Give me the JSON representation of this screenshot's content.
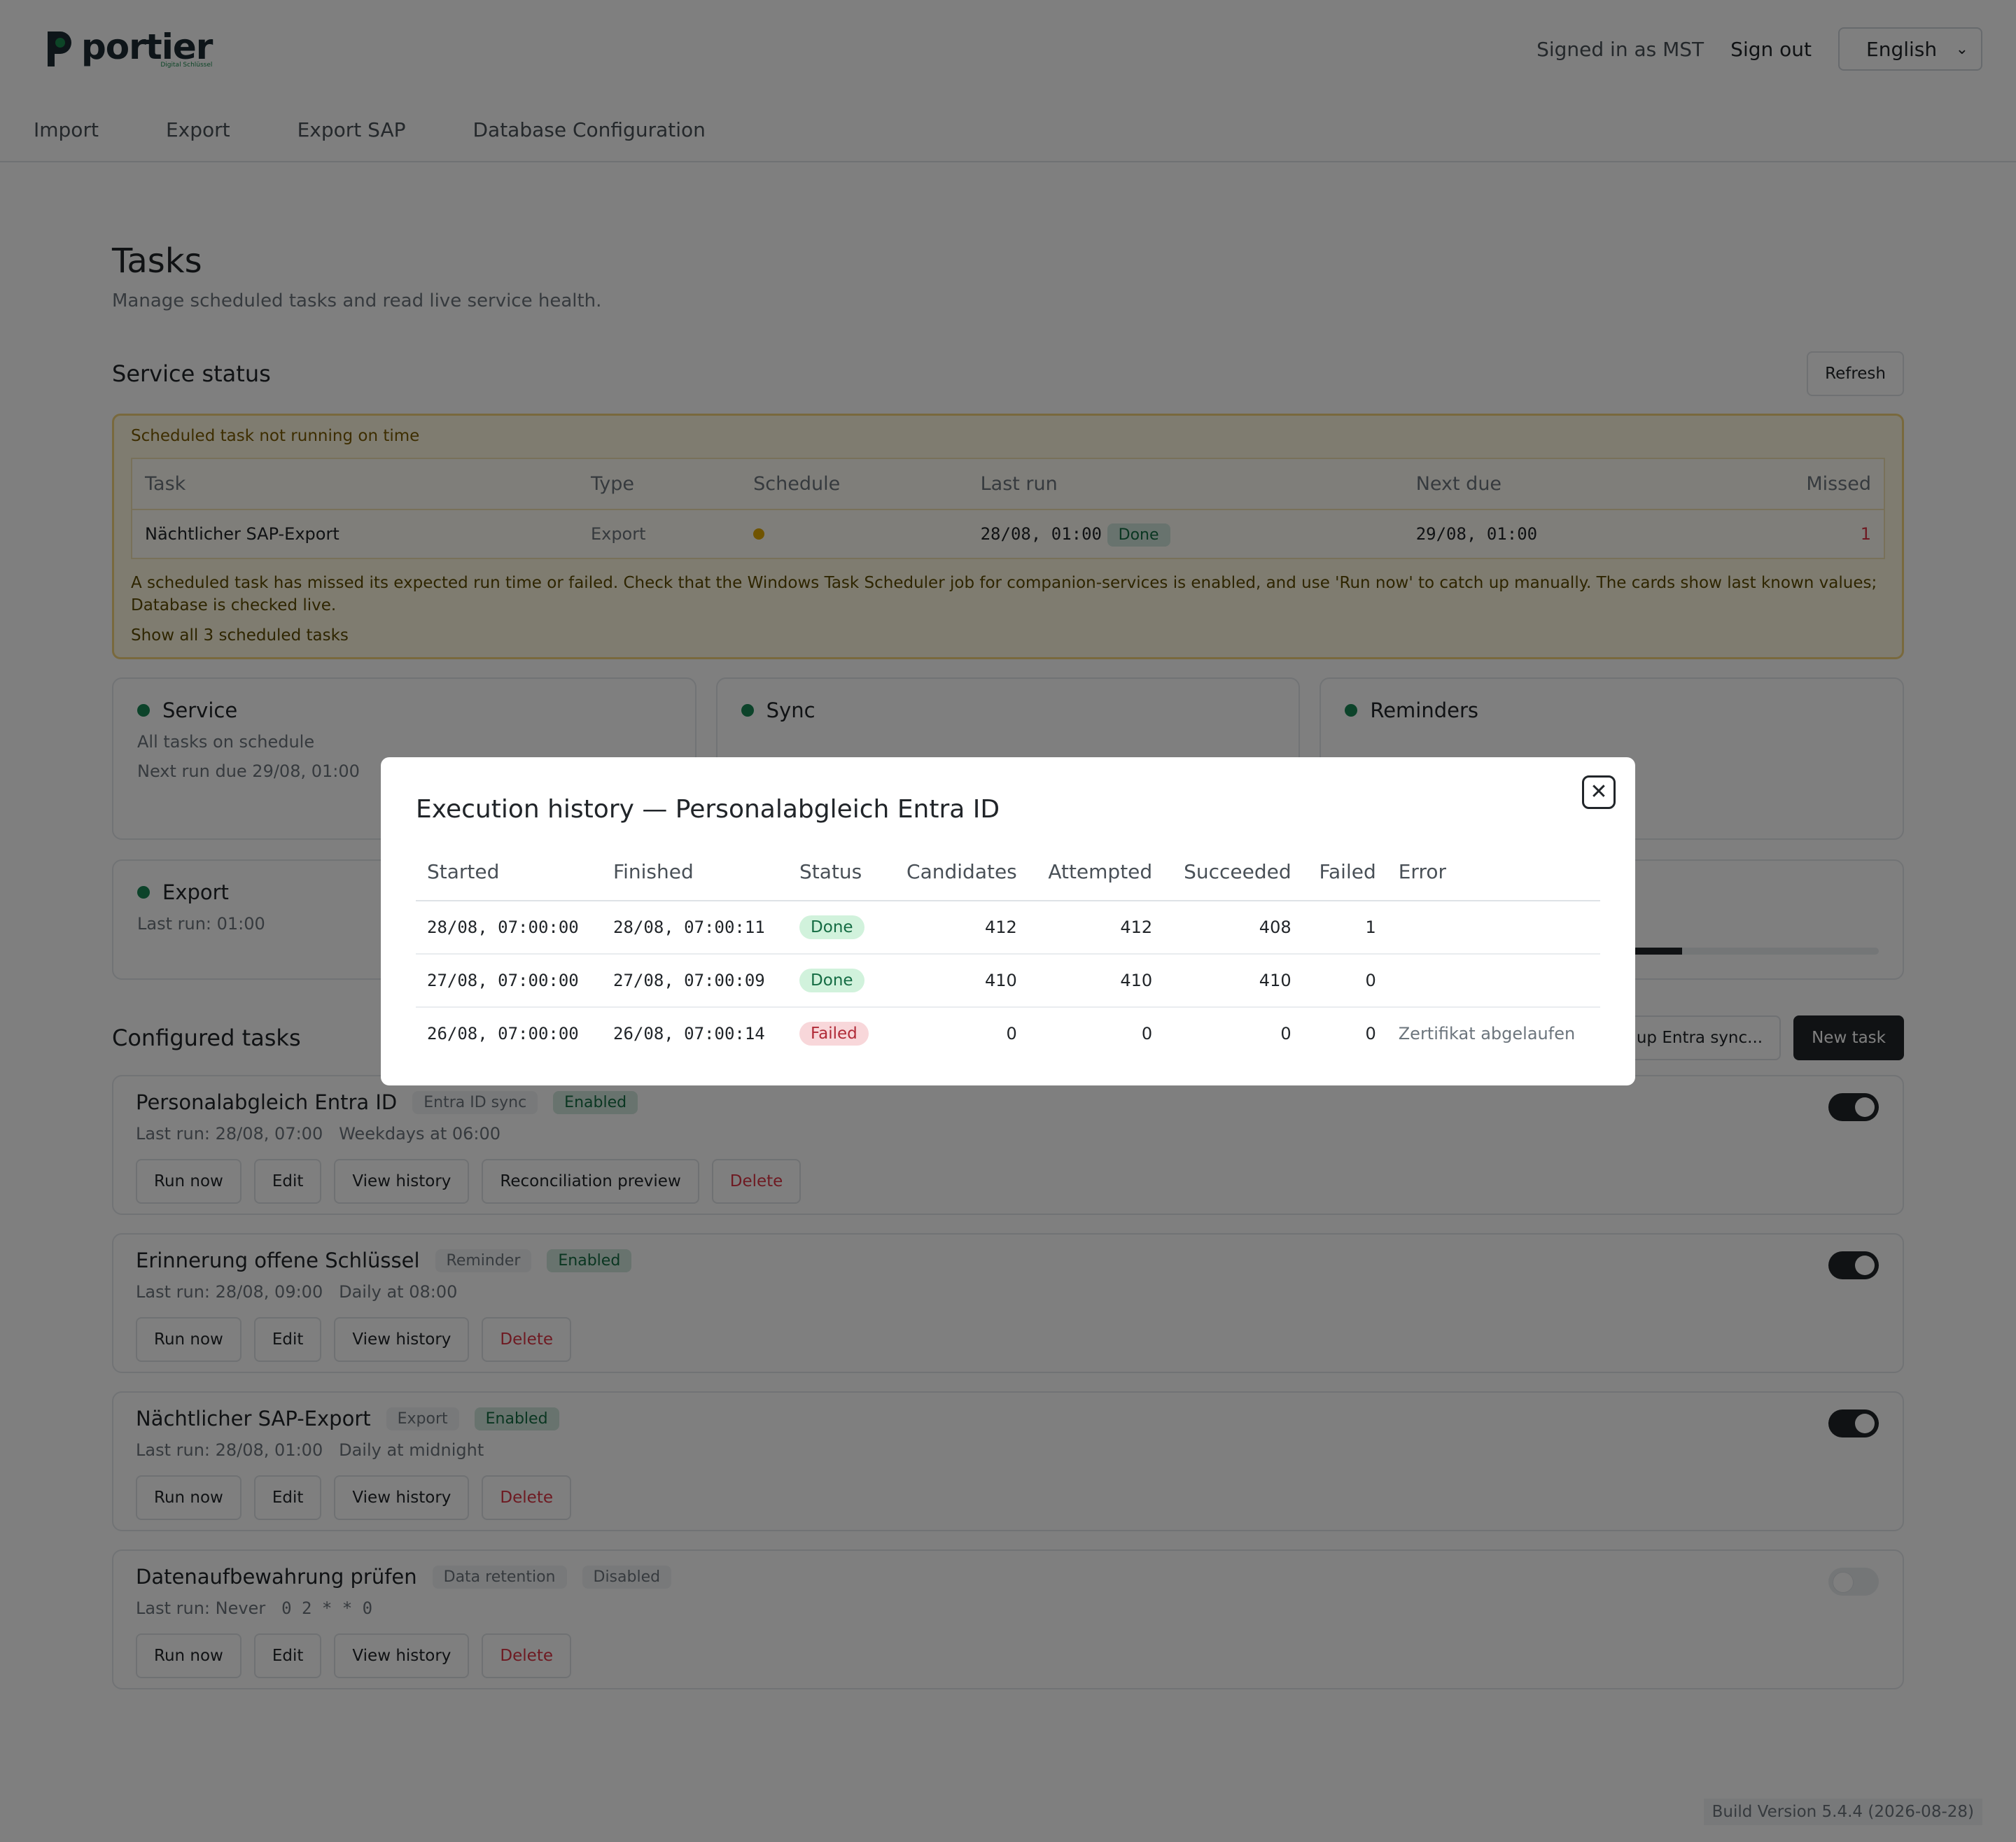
{
  "header": {
    "logo_text": "portier",
    "logo_tagline": "Digital Schlüssel",
    "signed_in": "Signed in as MST",
    "sign_out": "Sign out",
    "language": "English"
  },
  "nav": [
    "Import",
    "Export",
    "Export SAP",
    "Database Configuration"
  ],
  "page": {
    "title": "Tasks",
    "subtitle": "Manage scheduled tasks and read live service health."
  },
  "service_status": {
    "heading": "Service status",
    "refresh_label": "Refresh",
    "alert": {
      "title": "Scheduled task not running on time",
      "columns": [
        "Task",
        "Type",
        "Schedule",
        "Last run",
        "Next due",
        "Missed"
      ],
      "row": {
        "task": "Nächtlicher SAP-Export",
        "type": "Export",
        "last_run": "28/08, 01:00",
        "last_status": "Done",
        "next_due": "29/08, 01:00",
        "missed": "1"
      },
      "message": "A scheduled task has missed its expected run time or failed. Check that the Windows Task Scheduler job for companion-services is enabled, and use 'Run now' to catch up manually. The cards show last known values; Database is checked live.",
      "show_all": "Show all 3 scheduled tasks"
    },
    "cards": [
      {
        "title": "Service",
        "line1": "All tasks on schedule",
        "line2": "Next run due 29/08, 01:00"
      },
      {
        "title": "Sync",
        "line1": "",
        "line2": ""
      },
      {
        "title": "Reminders",
        "line1": "",
        "line2": ""
      }
    ],
    "export_card": {
      "title": "Export",
      "line1": "Last run: 01:00"
    }
  },
  "configured": {
    "heading": "Configured tasks",
    "setup_label": "et up Entra sync...",
    "new_task_label": "New task",
    "tasks": [
      {
        "name": "Personalabgleich Entra ID",
        "type": "Entra ID sync",
        "status": "Enabled",
        "last_run": "Last run: 28/08, 07:00",
        "schedule": "Weekdays at 06:00",
        "enabled": true,
        "actions": [
          "Run now",
          "Edit",
          "View history",
          "Reconciliation preview",
          "Delete"
        ]
      },
      {
        "name": "Erinnerung offene Schlüssel",
        "type": "Reminder",
        "status": "Enabled",
        "last_run": "Last run: 28/08, 09:00",
        "schedule": "Daily at 08:00",
        "enabled": true,
        "actions": [
          "Run now",
          "Edit",
          "View history",
          "Delete"
        ]
      },
      {
        "name": "Nächtlicher SAP-Export",
        "type": "Export",
        "status": "Enabled",
        "last_run": "Last run: 28/08, 01:00",
        "schedule": "Daily at midnight",
        "enabled": true,
        "actions": [
          "Run now",
          "Edit",
          "View history",
          "Delete"
        ]
      },
      {
        "name": "Datenaufbewahrung prüfen",
        "type": "Data retention",
        "status": "Disabled",
        "last_run": "Last run: Never",
        "schedule": "0 2 * * 0",
        "enabled": false,
        "actions": [
          "Run now",
          "Edit",
          "View history",
          "Delete"
        ]
      }
    ]
  },
  "footer": {
    "build": "Build Version 5.4.4 (2026-08-28)"
  },
  "modal": {
    "title": "Execution history — Personalabgleich Entra ID",
    "columns": [
      "Started",
      "Finished",
      "Status",
      "Candidates",
      "Attempted",
      "Succeeded",
      "Failed",
      "Error"
    ],
    "rows": [
      {
        "started": "28/08, 07:00:00",
        "finished": "28/08, 07:00:11",
        "status": "Done",
        "candidates": "412",
        "attempted": "412",
        "succeeded": "408",
        "failed": "1",
        "error": ""
      },
      {
        "started": "27/08, 07:00:00",
        "finished": "27/08, 07:00:09",
        "status": "Done",
        "candidates": "410",
        "attempted": "410",
        "succeeded": "410",
        "failed": "0",
        "error": ""
      },
      {
        "started": "26/08, 07:00:00",
        "finished": "26/08, 07:00:14",
        "status": "Failed",
        "candidates": "0",
        "attempted": "0",
        "succeeded": "0",
        "failed": "0",
        "error": "Zertifikat abgelaufen"
      }
    ]
  },
  "colors": {
    "accent": "#212529",
    "success": "#198754",
    "danger": "#dc3545",
    "warning_bg": "#fff8e1"
  }
}
